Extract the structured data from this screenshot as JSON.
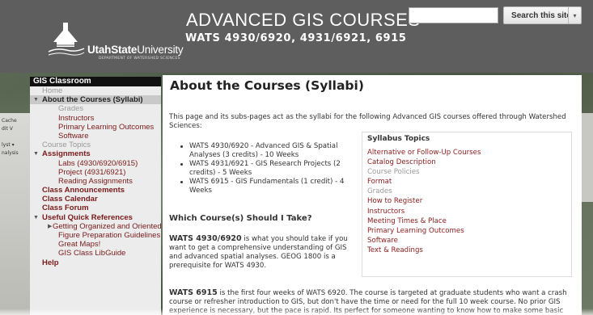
{
  "header": {
    "title": "ADVANCED GIS COURSES",
    "subtitle": "WATS 4930/6920, 4931/6921, 6915",
    "logo": {
      "word_light": "Utah",
      "word_bold": "State",
      "word_end": "University",
      "department": "DEPARTMENT OF WATERSHED SCIENCES"
    },
    "search": {
      "placeholder": "",
      "button_label": "Search this site",
      "dropdown_icon": "▾"
    }
  },
  "left_strip": [
    "Cache",
    "dit  V",
    "",
    "lyst ▾",
    "nalysis"
  ],
  "sidebar": {
    "title": "GIS Classroom",
    "items": [
      {
        "label": "Home",
        "level": 0,
        "style": "muted"
      },
      {
        "label": "About the Courses (Syllabi)",
        "level": 0,
        "style": "selected",
        "expanded": true
      },
      {
        "label": "Grades",
        "level": 2,
        "style": "muted"
      },
      {
        "label": "Instructors",
        "level": 2,
        "style": "link"
      },
      {
        "label": "Primary Learning Outcomes",
        "level": 2,
        "style": "link"
      },
      {
        "label": "Software",
        "level": 2,
        "style": "link"
      },
      {
        "label": "Course Topics",
        "level": 0,
        "style": "muted"
      },
      {
        "label": "Assignments",
        "level": 0,
        "style": "bold",
        "expanded": true
      },
      {
        "label": "Labs (4930/6920/6915)",
        "level": 2,
        "style": "link"
      },
      {
        "label": "Project (4931/6921)",
        "level": 2,
        "style": "link"
      },
      {
        "label": "Reading Assignments",
        "level": 2,
        "style": "link"
      },
      {
        "label": "Class Announcements",
        "level": 0,
        "style": "bold"
      },
      {
        "label": "Class Calendar",
        "level": 0,
        "style": "bold"
      },
      {
        "label": "Class Forum",
        "level": 0,
        "style": "bold"
      },
      {
        "label": "Useful Quick References",
        "level": 0,
        "style": "bold",
        "expanded": true
      },
      {
        "label": "Getting Organized and Oriented",
        "level": 1,
        "style": "link",
        "collapsed": true
      },
      {
        "label": "Figure Preparation Guidelines",
        "level": 2,
        "style": "link"
      },
      {
        "label": "Great Maps!",
        "level": 2,
        "style": "link"
      },
      {
        "label": "GIS Class LibGuide",
        "level": 2,
        "style": "link"
      },
      {
        "label": "Help",
        "level": 0,
        "style": "bold"
      }
    ]
  },
  "content": {
    "title": "About the Courses (Syllabi)",
    "intro": "This page and its subs-pages act as the syllabi for the following Advanced GIS courses offered through Watershed Sciences:",
    "bullets": [
      "WATS 4930/6920 - Advanced GIS & Spatial Analyses (3 credits) - 10 Weeks",
      "WATS 4931/6921 - GIS Research Projects (2 credits)  - 5 Weeks",
      "WATS 6915 - GIS Fundamentals (1 credit) - 4 Weeks"
    ],
    "heading2": "Which Course(s) Should I Take?",
    "para1_lead": "WATS 4930/6920",
    "para1_rest": " is what you should take if you want to get a comprehensive understanding of GIS and advanced spatial analyses. GEOG 1800 is a prerequisite for WATS 4930.",
    "para2_lead": "WATS 6915",
    "para2_rest": " is the first four weeks of WATS 6920. The course is targeted at graduate students who want a crash course or refresher introduction to GIS, but don't have the time or need for the full 10 week course. No prior GIS experience is necessary, but the pace is rapid. Its perfect for someone wanting to know how to make some basic",
    "topics": {
      "title": "Syllabus Topics",
      "items": [
        {
          "label": "Alternative or Follow-Up Courses",
          "muted": false
        },
        {
          "label": "Catalog Description",
          "muted": false
        },
        {
          "label": "Course Policies",
          "muted": true
        },
        {
          "label": "Format",
          "muted": false
        },
        {
          "label": "Grades",
          "muted": true
        },
        {
          "label": "How to Register",
          "muted": false
        },
        {
          "label": "Instructors",
          "muted": false
        },
        {
          "label": "Meeting Times & Place",
          "muted": false
        },
        {
          "label": "Primary Learning Outcomes",
          "muted": false
        },
        {
          "label": "Software",
          "muted": false
        },
        {
          "label": "Text & Readings",
          "muted": false
        }
      ]
    }
  },
  "colors": {
    "header_bg": "#5e5e5e",
    "sidebar_bg": "#ececec",
    "link": "#7a1a1a",
    "muted": "#999999"
  }
}
